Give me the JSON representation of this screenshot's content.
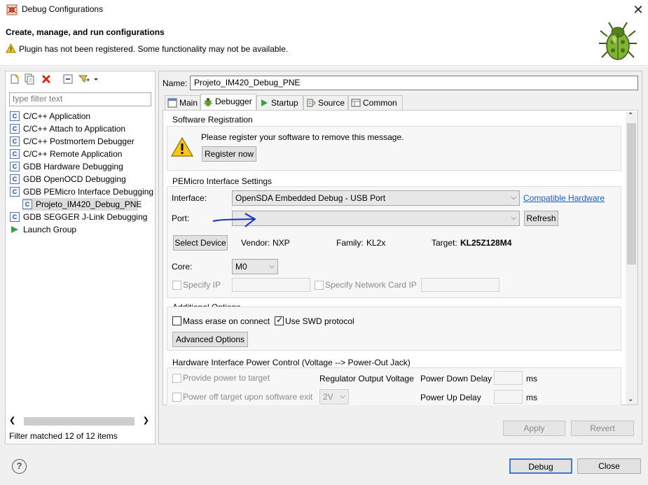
{
  "window": {
    "title": "Debug Configurations",
    "close_glyph": "✕"
  },
  "header": {
    "title": "Create, manage, and run configurations",
    "message": "Plugin has not been registered. Some functionality may not be available."
  },
  "left": {
    "filter_placeholder": "type filter text",
    "tree": [
      {
        "label": "C/C++ Application",
        "icon": "c-config-icon"
      },
      {
        "label": "C/C++ Attach to Application",
        "icon": "c-config-icon"
      },
      {
        "label": "C/C++ Postmortem Debugger",
        "icon": "c-config-icon"
      },
      {
        "label": "C/C++ Remote Application",
        "icon": "c-config-icon"
      },
      {
        "label": "GDB Hardware Debugging",
        "icon": "c-config-icon"
      },
      {
        "label": "GDB OpenOCD Debugging",
        "icon": "c-config-icon"
      },
      {
        "label": "GDB PEMicro Interface Debugging",
        "icon": "c-config-icon"
      },
      {
        "label": "Projeto_IM420_Debug_PNE",
        "icon": "c-config-icon"
      },
      {
        "label": "GDB SEGGER J-Link Debugging",
        "icon": "c-config-icon"
      },
      {
        "label": "Launch Group",
        "icon": "launch-group-icon"
      }
    ],
    "icon_glyph": "C",
    "status": "Filter matched 12 of 12 items"
  },
  "right": {
    "name_label": "Name:",
    "name_value": "Projeto_IM420_Debug_PNE",
    "tabs": [
      "Main",
      "Debugger",
      "Startup",
      "Source",
      "Common"
    ],
    "software_registration": {
      "title": "Software Registration",
      "message": "Please register your software to remove this message.",
      "register_button": "Register now"
    },
    "pemicro": {
      "title": "PEMicro Interface Settings",
      "interface_label": "Interface:",
      "interface_value": "OpenSDA Embedded Debug - USB Port",
      "compatible_link": "Compatible Hardware",
      "port_label": "Port:",
      "port_value": "",
      "refresh_button": "Refresh",
      "select_device_button": "Select Device",
      "vendor_label": "Vendor:",
      "vendor_value": "NXP",
      "family_label": "Family:",
      "family_value": "KL2x",
      "target_label": "Target:",
      "target_value": "KL25Z128M4",
      "core_label": "Core:",
      "core_value": "M0",
      "specify_ip_label": "Specify IP",
      "specify_nic_label": "Specify Network Card IP"
    },
    "additional": {
      "title": "Additional Options",
      "mass_erase_label": "Mass erase on connect",
      "mass_erase_checked": false,
      "swd_label": "Use SWD protocol",
      "swd_checked": true,
      "advanced_button": "Advanced Options"
    },
    "power": {
      "title": "Hardware Interface Power Control (Voltage --> Power-Out Jack)",
      "provide_power_label": "Provide power to target",
      "regulator_label": "Regulator Output Voltage",
      "power_down_label": "Power Down Delay",
      "power_down_unit": "ms",
      "power_off_label": "Power off target upon software exit",
      "voltage_value": "2V",
      "power_up_label": "Power Up Delay",
      "power_up_unit": "ms"
    },
    "apply_button": "Apply",
    "revert_button": "Revert"
  },
  "footer": {
    "help_glyph": "?",
    "debug_button": "Debug",
    "close_button": "Close"
  },
  "colors": {
    "link": "#1a5fb4",
    "annotation_arrow": "#1d2fb5",
    "selection": "#dcdcdc"
  }
}
